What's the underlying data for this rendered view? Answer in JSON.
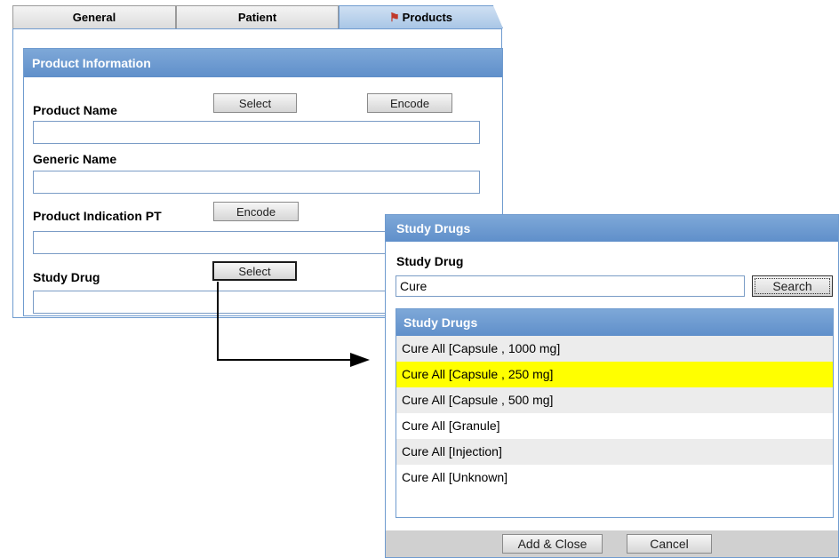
{
  "tabs": [
    {
      "label": "General",
      "active": false
    },
    {
      "label": "Patient",
      "active": false
    },
    {
      "label": "Products",
      "active": true,
      "icon": "flag-icon"
    }
  ],
  "product_panel": {
    "title": "Product Information",
    "product_name_label": "Product Name",
    "product_name_value": "",
    "generic_name_label": "Generic Name",
    "generic_name_value": "",
    "indication_label": "Product Indication PT",
    "indication_value": "",
    "study_drug_label": "Study Drug",
    "study_drug_value": "",
    "select_label": "Select",
    "encode_label": "Encode"
  },
  "dialog": {
    "title": "Study Drugs",
    "field_label": "Study Drug",
    "search_value": "Cure",
    "search_button": "Search",
    "list_title": "Study Drugs",
    "items": [
      "Cure All [Capsule , 1000 mg]",
      "Cure All [Capsule , 250 mg]",
      "Cure All [Capsule , 500 mg]",
      "Cure All [Granule]",
      "Cure All [Injection]",
      "Cure All [Unknown]"
    ],
    "selected_index": 1,
    "highlight_color": "#ffff00",
    "add_close_label": "Add & Close",
    "cancel_label": "Cancel"
  },
  "colors": {
    "header_blue": "#6f9bcf",
    "accent": "#c0392b"
  }
}
